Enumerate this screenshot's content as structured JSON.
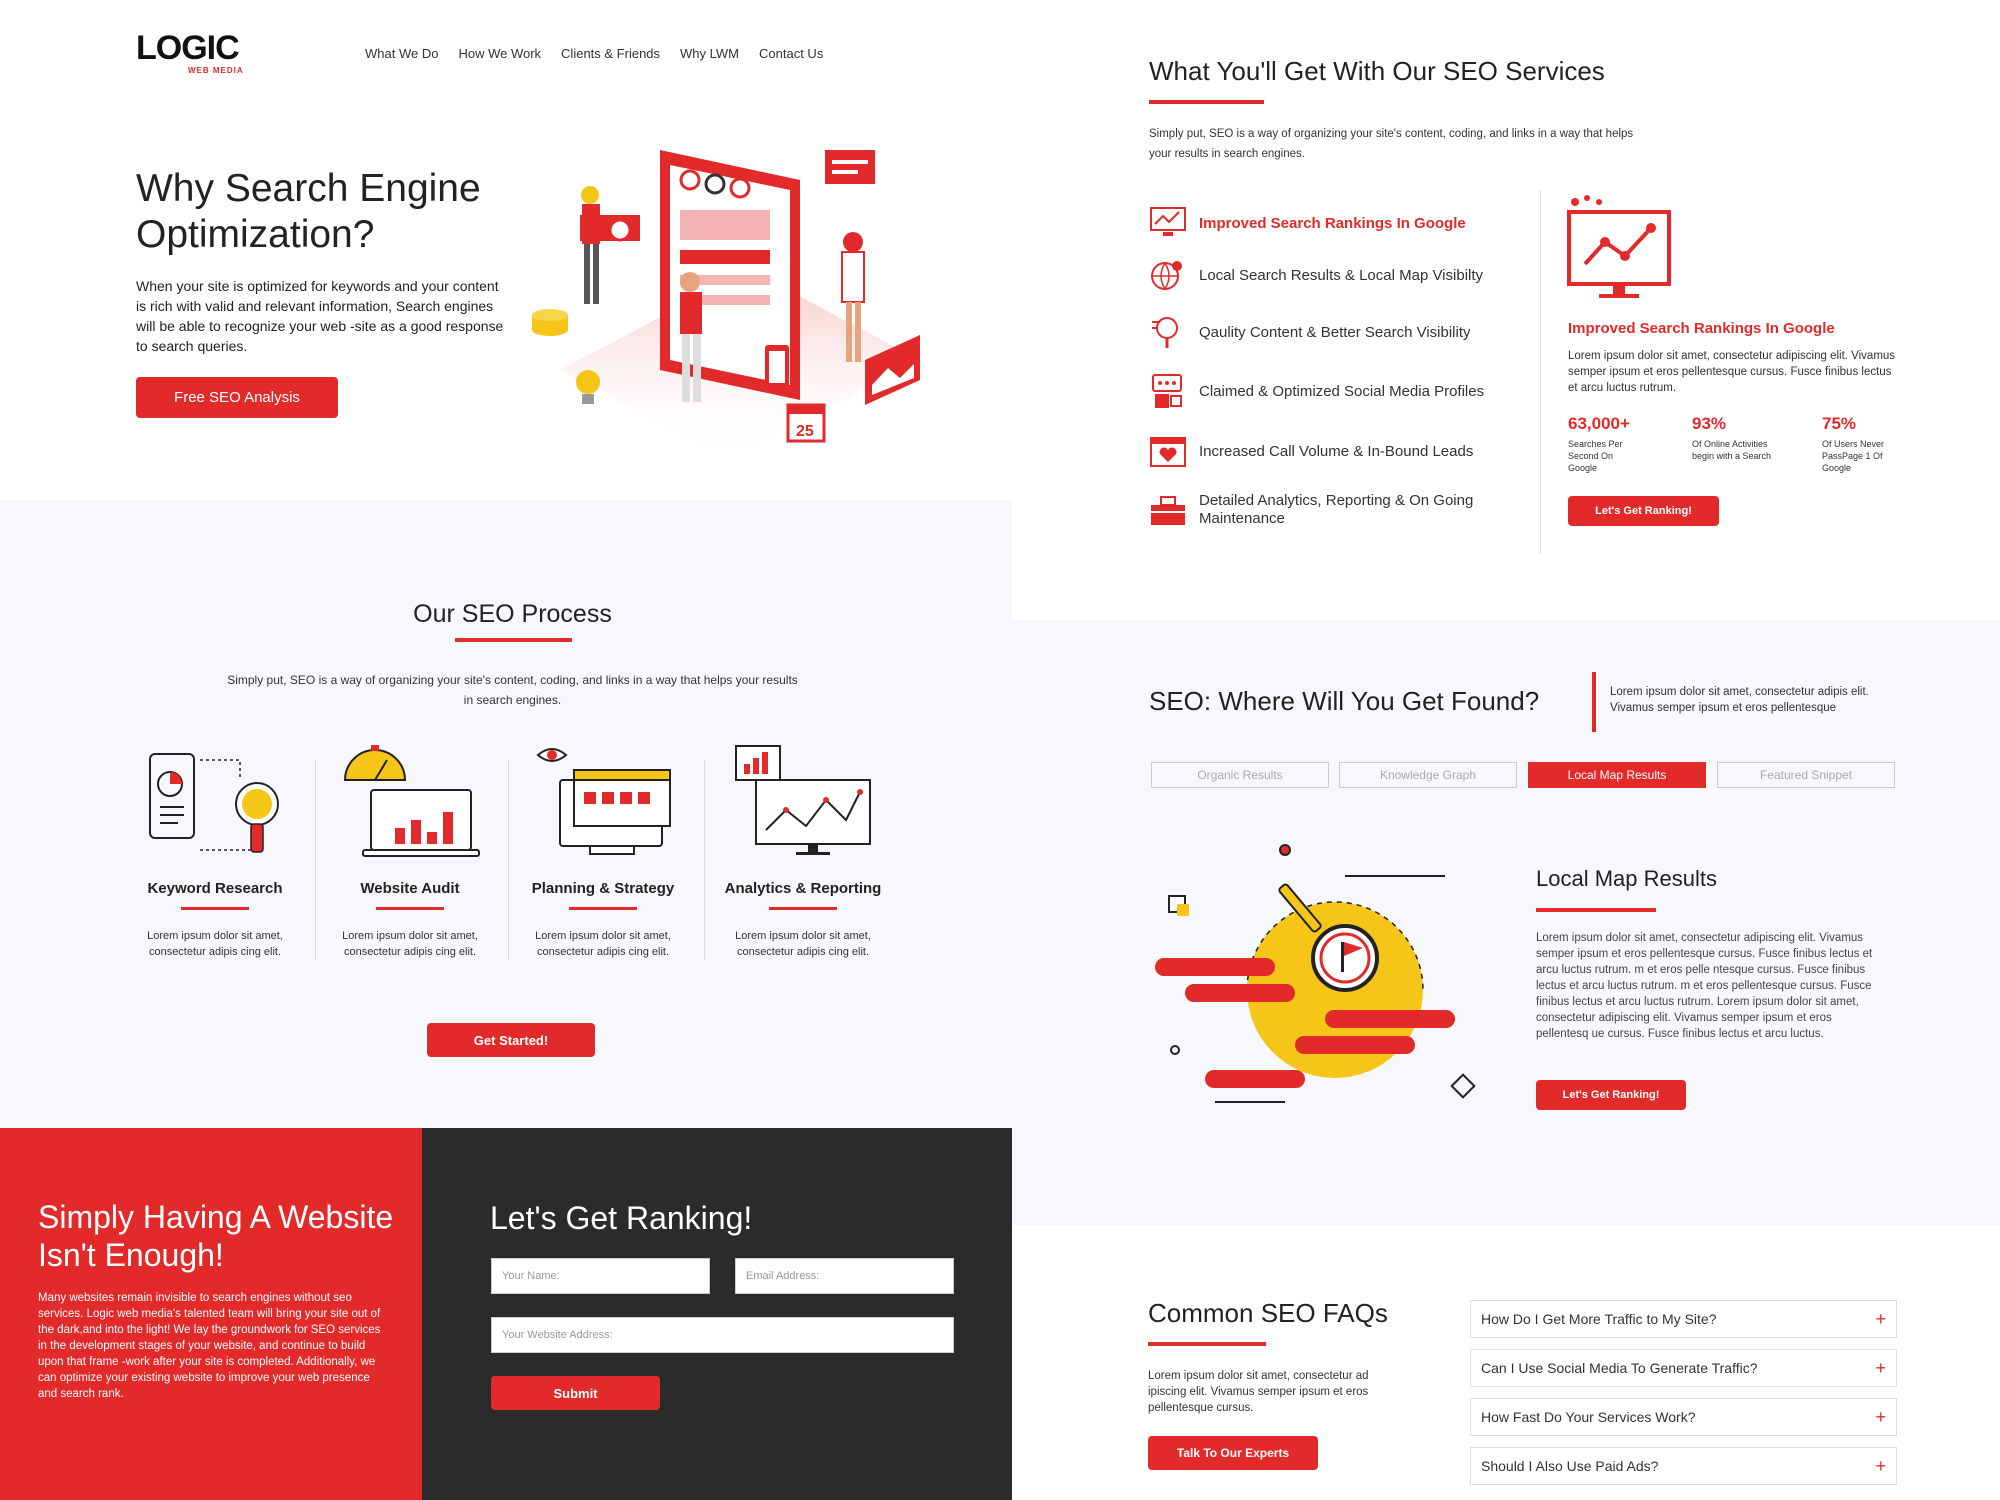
{
  "logo": {
    "brand": "LOGIC",
    "sub": "WEB MEDIA"
  },
  "nav": [
    "What We Do",
    "How We Work",
    "Clients & Friends",
    "Why LWM",
    "Contact Us"
  ],
  "hero": {
    "title": "Why Search Engine Optimization?",
    "text": "When your site is optimized for keywords and your content is rich with valid and relevant information, Search engines will be able to recognize your web -site as a good response to search queries.",
    "button": "Free SEO Analysis",
    "calendar_day": "25"
  },
  "services": {
    "title": "What You'll Get With Our SEO Services",
    "intro": "Simply put, SEO is a way of organizing your site's content, coding, and links in a way that helps your results in search engines.",
    "items": [
      {
        "label": "Improved Search Rankings In Google",
        "icon": "chart-monitor-icon"
      },
      {
        "label": "Local Search Results & Local Map Visibilty",
        "icon": "globe-pin-icon"
      },
      {
        "label": "Qaulity Content & Better Search Visibility",
        "icon": "search-content-icon"
      },
      {
        "label": "Claimed & Optimized Social Media Profiles",
        "icon": "social-profile-icon"
      },
      {
        "label": "Increased Call Volume & In-Bound Leads",
        "icon": "heart-calendar-icon"
      },
      {
        "label": "Detailed Analytics, Reporting & On Going Maintenance",
        "icon": "toolbox-icon"
      }
    ],
    "detail": {
      "title": "Improved Search Rankings In Google",
      "text": "Lorem ipsum dolor sit amet, consectetur adipiscing elit. Vivamus semper ipsum et eros pellentesque cursus. Fusce finibus lectus et arcu luctus rutrum.",
      "stats": [
        {
          "num": "63,000+",
          "label": "Searches Per Second On Google"
        },
        {
          "num": "93%",
          "label": "Of Online Activities begin with a Search"
        },
        {
          "num": "75%",
          "label": "Of Users Never PassPage 1 Of Google"
        }
      ],
      "button": "Let's Get Ranking!"
    }
  },
  "process": {
    "title": "Our SEO Process",
    "intro": "Simply put, SEO is a way of organizing your site's content, coding, and links in a way that helps your results in search engines.",
    "steps": [
      {
        "title": "Keyword Research",
        "desc": "Lorem ipsum dolor sit amet, consectetur adipis cing elit."
      },
      {
        "title": "Website Audit",
        "desc": "Lorem ipsum dolor sit amet, consectetur adipis cing elit."
      },
      {
        "title": "Planning & Strategy",
        "desc": "Lorem ipsum dolor sit amet, consectetur adipis cing elit."
      },
      {
        "title": "Analytics & Reporting",
        "desc": "Lorem ipsum dolor sit amet, consectetur adipis cing elit."
      }
    ],
    "button": "Get Started!"
  },
  "found": {
    "title": "SEO: Where Will You Get Found?",
    "side": "Lorem ipsum dolor sit amet, consectetur adipis elit. Vivamus semper ipsum et eros pellentesque",
    "tabs": [
      "Organic Results",
      "Knowledge Graph",
      "Local Map Results",
      "Featured Snippet"
    ],
    "active_tab": 2,
    "detail_title": "Local Map Results",
    "detail_text": "Lorem ipsum dolor sit amet, consectetur adipiscing elit. Vivamus semper ipsum et eros pellentesque cursus. Fusce finibus lectus et arcu luctus rutrum. m et eros pelle ntesque cursus. Fusce finibus lectus et arcu luctus rutrum. m et eros pellentesque cursus. Fusce finibus lectus et arcu luctus rutrum. Lorem ipsum dolor sit amet, consectetur adipiscing elit. Vivamus semper ipsum et eros pellentesq ue cursus. Fusce finibus lectus et arcu luctus.",
    "button": "Let's Get Ranking!"
  },
  "cta": {
    "title": "Simply Having A Website Isn't Enough!",
    "text": "Many websites remain invisible to search engines without seo services. Logic web media's talented team will bring your site out of the dark,and into the light! We lay the groundwork for SEO services in the development stages of your website, and continue to build upon that frame -work after your site is completed. Additionally, we can optimize your existing website to improve your web presence and search rank."
  },
  "form": {
    "title": "Let's Get Ranking!",
    "name_ph": "Your Name:",
    "email_ph": "Email Address:",
    "website_ph": "Your Website Address:",
    "submit": "Submit"
  },
  "faq": {
    "title": "Common SEO FAQs",
    "text": "Lorem ipsum dolor sit amet, consectetur ad ipiscing elit. Vivamus semper ipsum et eros pellentesque cursus.",
    "button": "Talk To Our Experts",
    "items": [
      "How Do I Get More Traffic to My Site?",
      "Can I Use Social Media To Generate Traffic?",
      "How Fast Do Your Services Work?",
      "Should I Also Use Paid Ads?"
    ],
    "toggle": "+"
  },
  "colors": {
    "accent": "#e22a2a",
    "dark": "#2b2b2b",
    "yellow": "#f5c518"
  }
}
